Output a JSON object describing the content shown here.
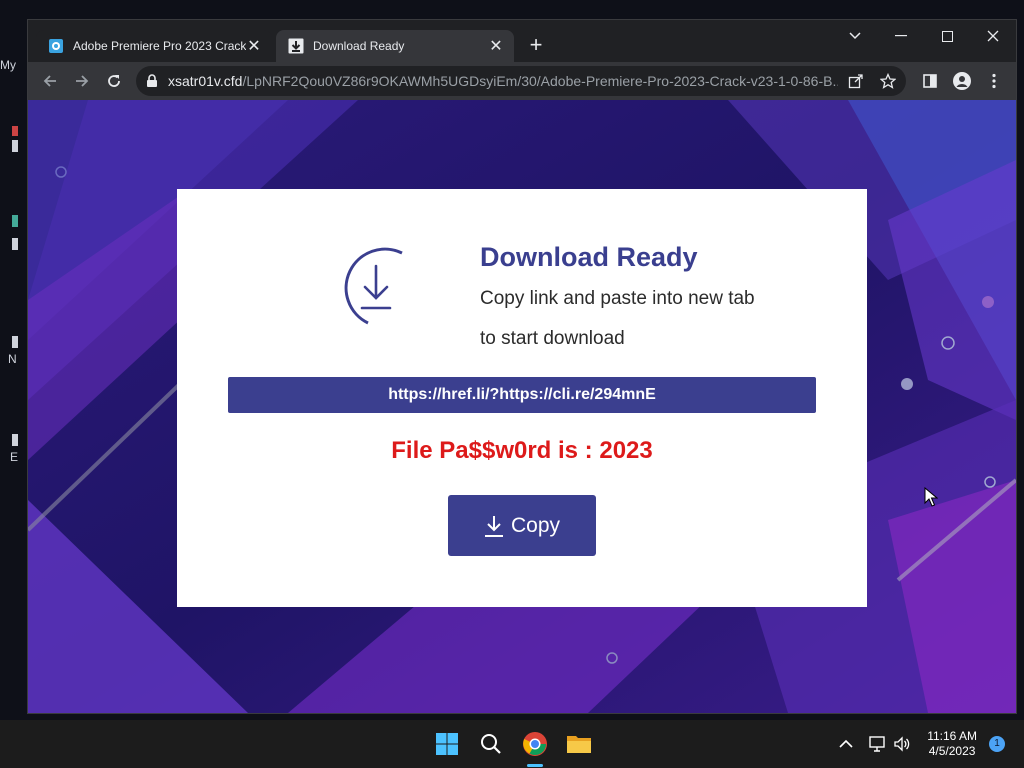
{
  "desktop": {
    "labels": [
      "My",
      "N",
      "E"
    ]
  },
  "browser": {
    "tabs": [
      {
        "title": "Adobe Premiere Pro 2023 Crack",
        "active": false,
        "icon": "app-icon"
      },
      {
        "title": "Download Ready",
        "active": true,
        "icon": "download-icon"
      }
    ],
    "address": {
      "host": "xsatr01v.cfd",
      "path": "/LpNRF2Qou0VZ86r9OKAWMh5UGDsyiEm/30/Adobe-Premiere-Pro-2023-Crack-v23-1-0-86-B..."
    }
  },
  "page": {
    "heading": "Download Ready",
    "line1": "Copy link and paste into new tab",
    "line2": "to start download",
    "link": "https://href.li/?https://cli.re/294mnE",
    "password": "File Pa$$w0rd is : 2023",
    "copy_label": "Copy"
  },
  "taskbar": {
    "time": "11:16 AM",
    "date": "4/5/2023",
    "notifications": "1"
  },
  "colors": {
    "accent": "#3b3f8f",
    "password": "#dd1a1a",
    "background_purple": "#2a1870"
  }
}
